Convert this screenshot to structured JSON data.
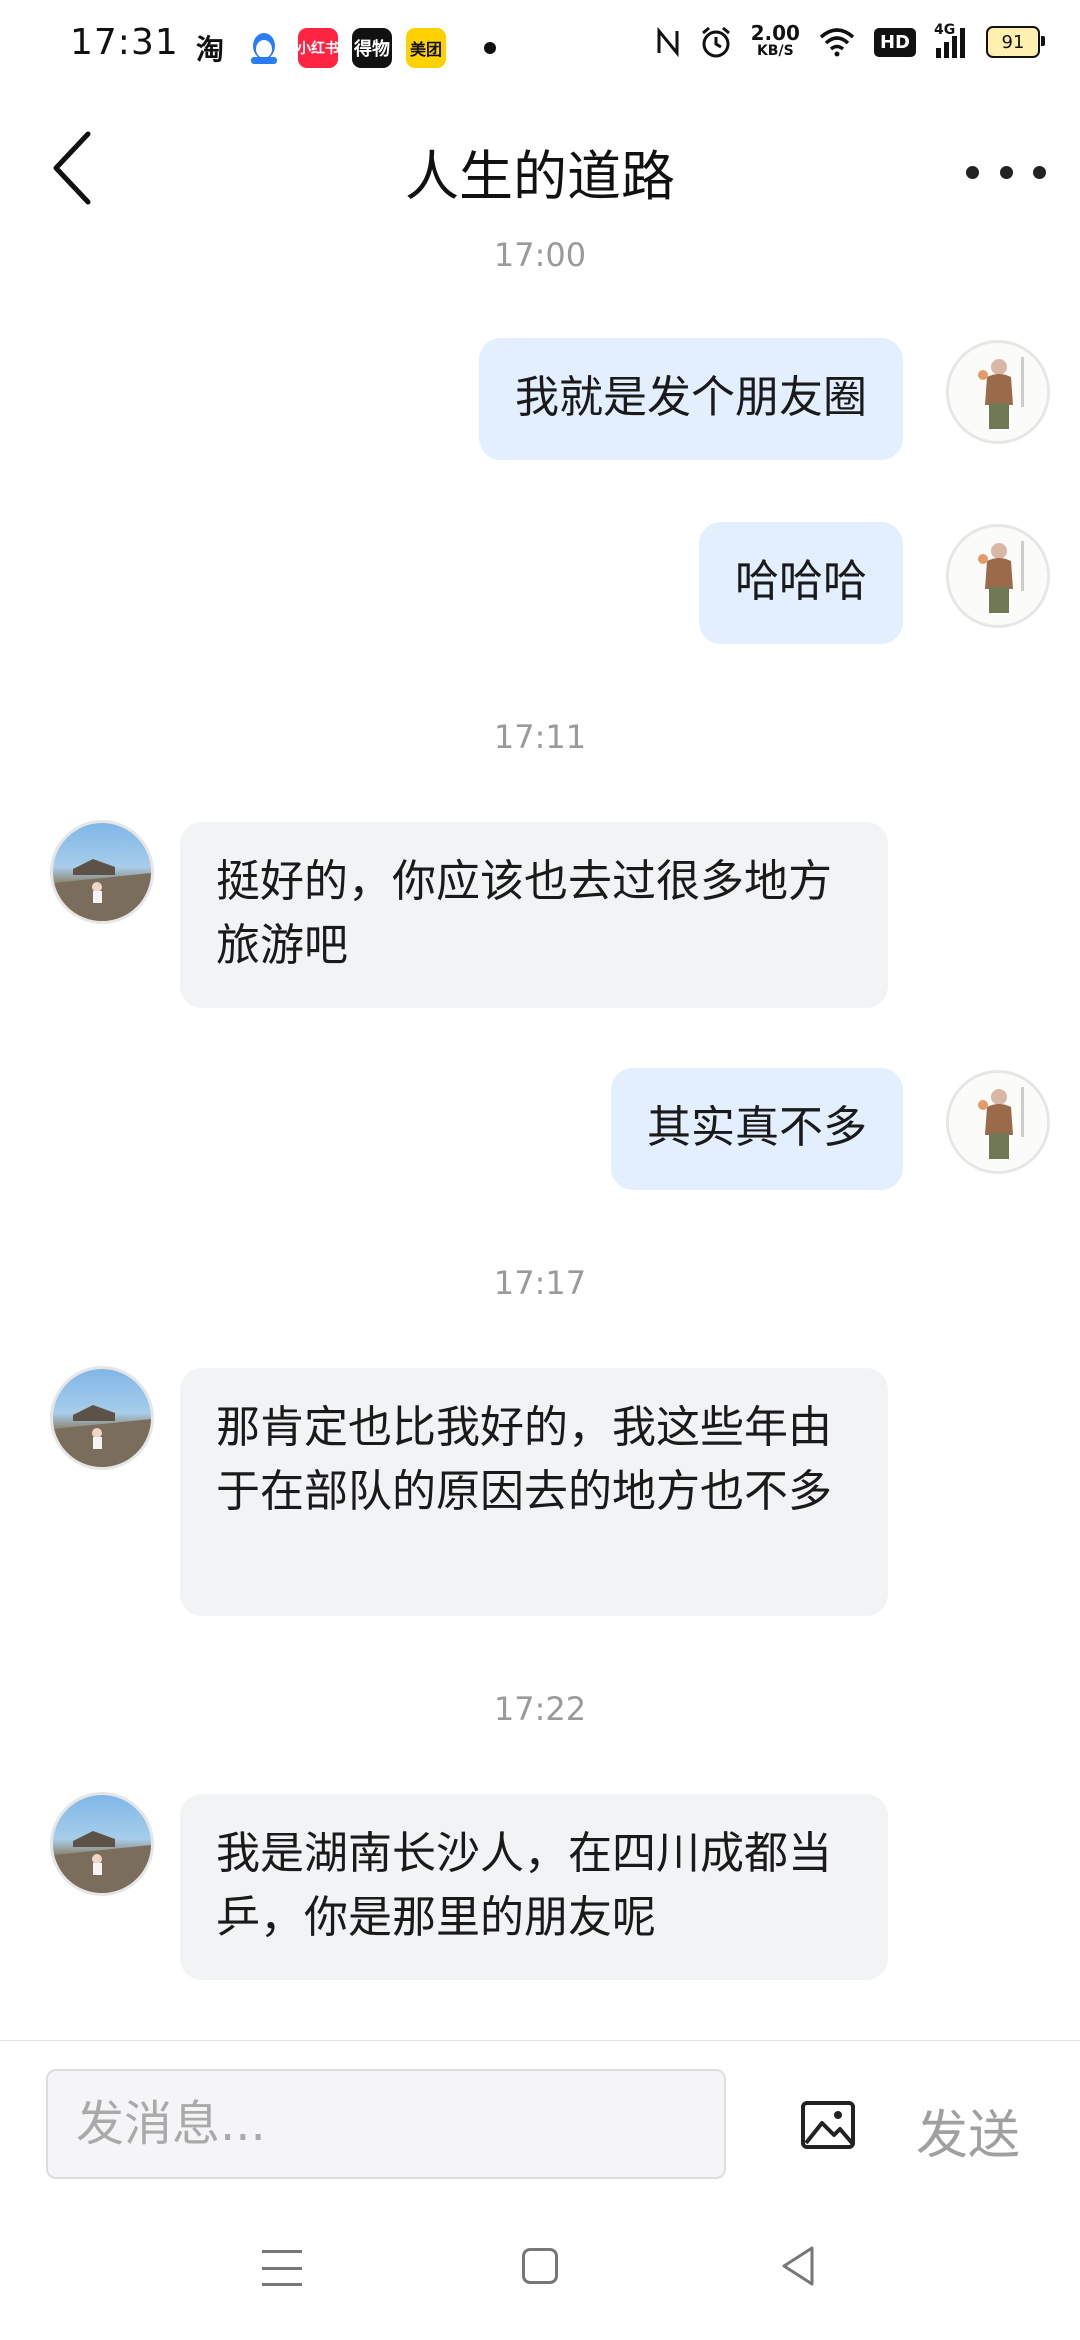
{
  "status_bar": {
    "time": "17:31",
    "apps": [
      {
        "label": "淘",
        "color": "#ffffff",
        "text": "#111111"
      },
      {
        "label": "",
        "color": "#2a7cf6",
        "text": "#ffffff"
      },
      {
        "label": "小红书",
        "color": "#ff2442",
        "text": "#ffffff"
      },
      {
        "label": "得物",
        "color": "#111111",
        "text": "#ffffff"
      },
      {
        "label": "美团",
        "color": "#ffd100",
        "text": "#111111"
      }
    ],
    "net_speed_value": "2.00",
    "net_speed_unit": "KB/S",
    "hd": "HD",
    "signal": "4G",
    "battery": "91"
  },
  "header": {
    "title": "人生的道路"
  },
  "messages": [
    {
      "kind": "time",
      "text": "17:00"
    },
    {
      "kind": "out",
      "text": "我就是发个朋友圈"
    },
    {
      "kind": "out",
      "text": "哈哈哈"
    },
    {
      "kind": "time",
      "text": "17:11"
    },
    {
      "kind": "in",
      "text": "挺好的，你应该也去过很多地方旅游吧"
    },
    {
      "kind": "out",
      "text": "其实真不多"
    },
    {
      "kind": "time",
      "text": "17:17"
    },
    {
      "kind": "in",
      "text": "那肯定也比我好的，我这些年由于在部队的原因去的地方也不多"
    },
    {
      "kind": "time",
      "text": "17:22"
    },
    {
      "kind": "in",
      "text": "我是湖南长沙人，在四川成都当乒，你是那里的朋友呢"
    }
  ],
  "input": {
    "placeholder": "发消息...",
    "send_label": "发送"
  },
  "colors": {
    "outgoing_bubble": "#e3eefe",
    "incoming_bubble": "#f2f3f5",
    "timestamp": "#9a9a9a"
  }
}
